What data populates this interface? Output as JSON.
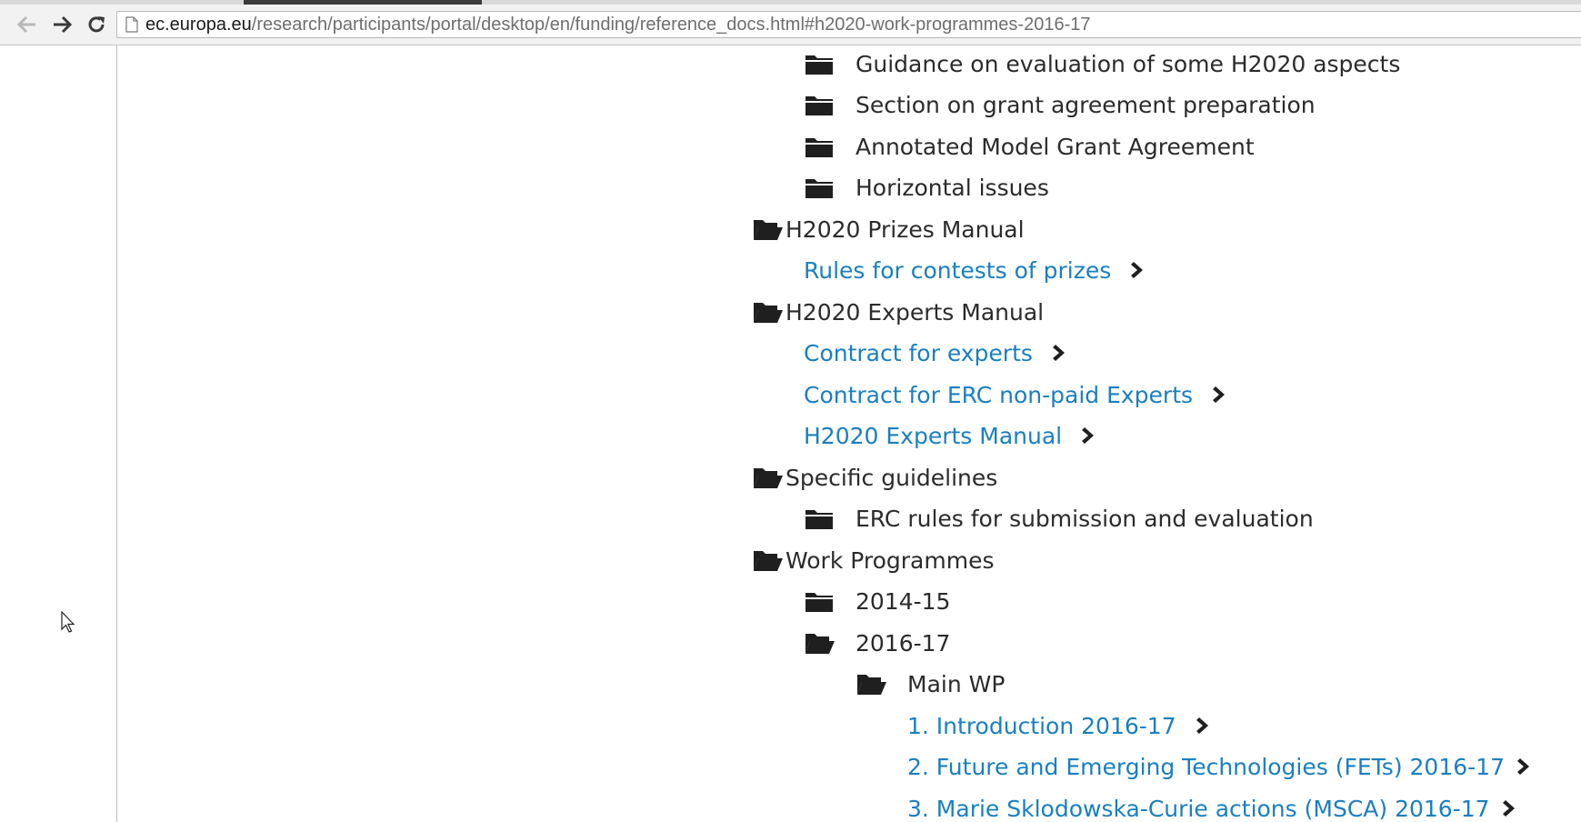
{
  "browser": {
    "url_host": "ec.europa.eu",
    "url_path": "/research/participants/portal/desktop/en/funding/reference_docs.html#h2020-work-programmes-2016-17",
    "buttons": [
      "back",
      "forward",
      "reload"
    ]
  },
  "tree": {
    "guidance": "Guidance on evaluation of some H2020 aspects",
    "grant_prep": "Section on grant agreement preparation",
    "annotated_mga": "Annotated Model Grant Agreement",
    "horizontal": "Horizontal issues",
    "prizes_manual": "H2020 Prizes Manual",
    "rules_prizes": "Rules for contests of prizes",
    "experts_manual_folder": "H2020 Experts Manual",
    "contract_experts": "Contract for experts",
    "contract_erc": "Contract for ERC non-paid Experts",
    "experts_manual_link": "H2020 Experts Manual",
    "specific_guidelines": "Specific guidelines",
    "erc_rules": "ERC rules for submission and evaluation",
    "work_programmes": "Work Programmes",
    "wp_2014": "2014-15",
    "wp_2016": "2016-17",
    "main_wp": "Main WP",
    "intro": "1. Introduction 2016-17",
    "fet": "2. Future and Emerging Technologies (FETs) 2016-17",
    "msca": "3. Marie Sklodowska-Curie actions (MSCA) 2016-17"
  },
  "colors": {
    "link": "#1a7fc1",
    "text": "#2b2b2b",
    "icon": "#1f1f1f"
  },
  "icons": {
    "closed_folder": "folder-closed-icon",
    "open_folder": "folder-open-icon",
    "chevron": "chevron-right-icon"
  }
}
